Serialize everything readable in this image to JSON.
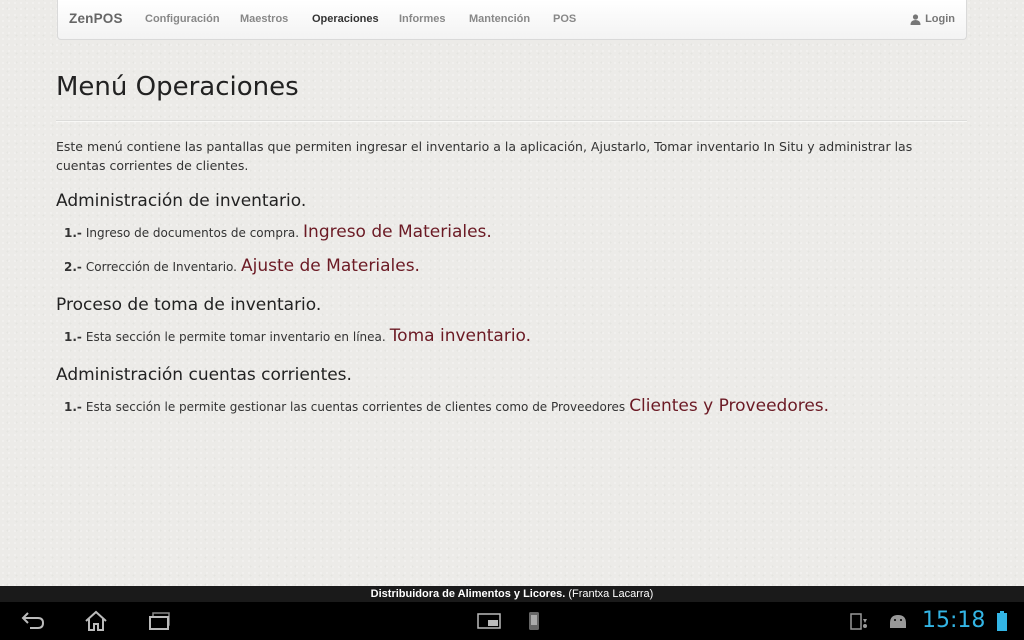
{
  "navbar": {
    "brand": "ZenPOS",
    "items": [
      {
        "label": "Configuración"
      },
      {
        "label": "Maestros"
      },
      {
        "label": "Operaciones"
      },
      {
        "label": "Informes"
      },
      {
        "label": "Mantención"
      },
      {
        "label": "POS"
      }
    ],
    "login_label": "Login"
  },
  "page": {
    "title": "Menú Operaciones",
    "intro": "Este menú contiene las pantallas que permiten ingresar el inventario a la aplicación, Ajustarlo, Tomar inventario In Situ y administrar las cuentas corrientes de clientes."
  },
  "sections": [
    {
      "title": "Administración de inventario.",
      "items": [
        {
          "num": "1.-",
          "text": "Ingreso de documentos de compra.",
          "link": "Ingreso de Materiales."
        },
        {
          "num": "2.-",
          "text": "Corrección de Inventario.",
          "link": "Ajuste de Materiales."
        }
      ]
    },
    {
      "title": "Proceso de toma de inventario.",
      "items": [
        {
          "num": "1.-",
          "text": "Esta sección le permite tomar inventario en línea.",
          "link": "Toma inventario."
        }
      ]
    },
    {
      "title": "Administración cuentas corrientes.",
      "items": [
        {
          "num": "1.-",
          "text": "Esta sección le permite gestionar las cuentas corrientes de clientes como de Proveedores",
          "link": "Clientes y Proveedores."
        }
      ]
    }
  ],
  "footer": {
    "company": "Distribuidora de Alimentos y Licores.",
    "user": "(Frantxa Lacarra)"
  },
  "system_bar": {
    "time": "15:18",
    "icons": [
      "back-icon",
      "home-icon",
      "recent-apps-icon",
      "screenshot-icon",
      "phone-icon",
      "usb-debug-icon",
      "android-icon",
      "battery-icon"
    ]
  },
  "colors": {
    "link": "#6b1a24",
    "clock": "#33b5e5",
    "background": "#ecebe8"
  }
}
